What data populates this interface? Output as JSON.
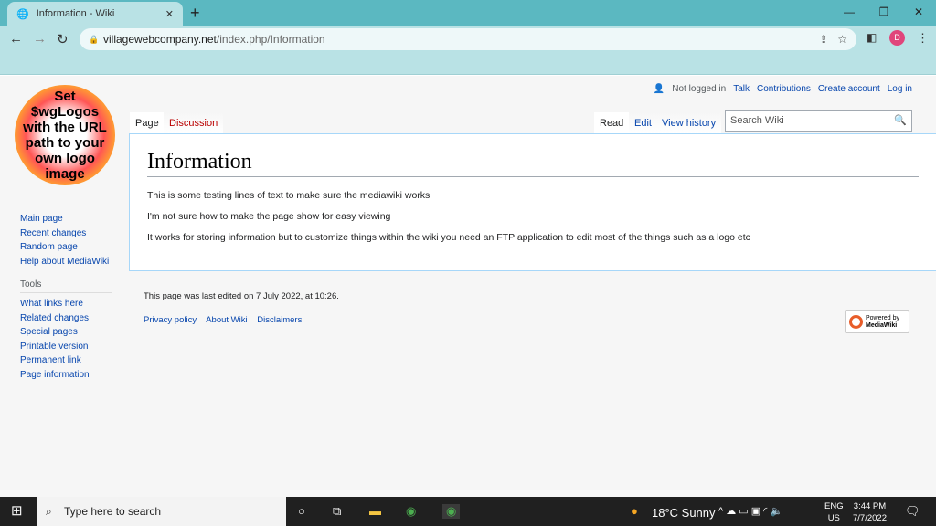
{
  "browser": {
    "tab_title": "Information - Wiki",
    "url_domain": "villagewebcompany.net",
    "url_path": "/index.php/Information",
    "avatar_letter": "D"
  },
  "logo_text": "Set $wgLogos with the URL path to your own logo image",
  "personal": {
    "status": "Not logged in",
    "links": [
      "Talk",
      "Contributions",
      "Create account",
      "Log in"
    ]
  },
  "tabs": {
    "left": [
      "Page",
      "Discussion"
    ],
    "right": [
      "Read",
      "Edit",
      "View history"
    ]
  },
  "search_placeholder": "Search Wiki",
  "sidebar": {
    "nav": [
      "Main page",
      "Recent changes",
      "Random page",
      "Help about MediaWiki"
    ],
    "tools_heading": "Tools",
    "tools": [
      "What links here",
      "Related changes",
      "Special pages",
      "Printable version",
      "Permanent link",
      "Page information"
    ]
  },
  "article": {
    "title": "Information",
    "paragraphs": [
      "This is some testing lines of text to make sure the mediawiki works",
      "I'm not sure how to make the page show for easy viewing",
      "It works for storing information but to customize things within the wiki you need an FTP application to edit most of the things such as a logo etc"
    ]
  },
  "footer": {
    "last_edited": "This page was last edited on 7 July 2022, at 10:26.",
    "links": [
      "Privacy policy",
      "About Wiki",
      "Disclaimers"
    ],
    "powered_line1": "Powered by",
    "powered_line2": "MediaWiki"
  },
  "taskbar": {
    "search_placeholder": "Type here to search",
    "weather": "18°C  Sunny",
    "lang1": "ENG",
    "lang2": "US",
    "time": "3:44 PM",
    "date": "7/7/2022"
  }
}
